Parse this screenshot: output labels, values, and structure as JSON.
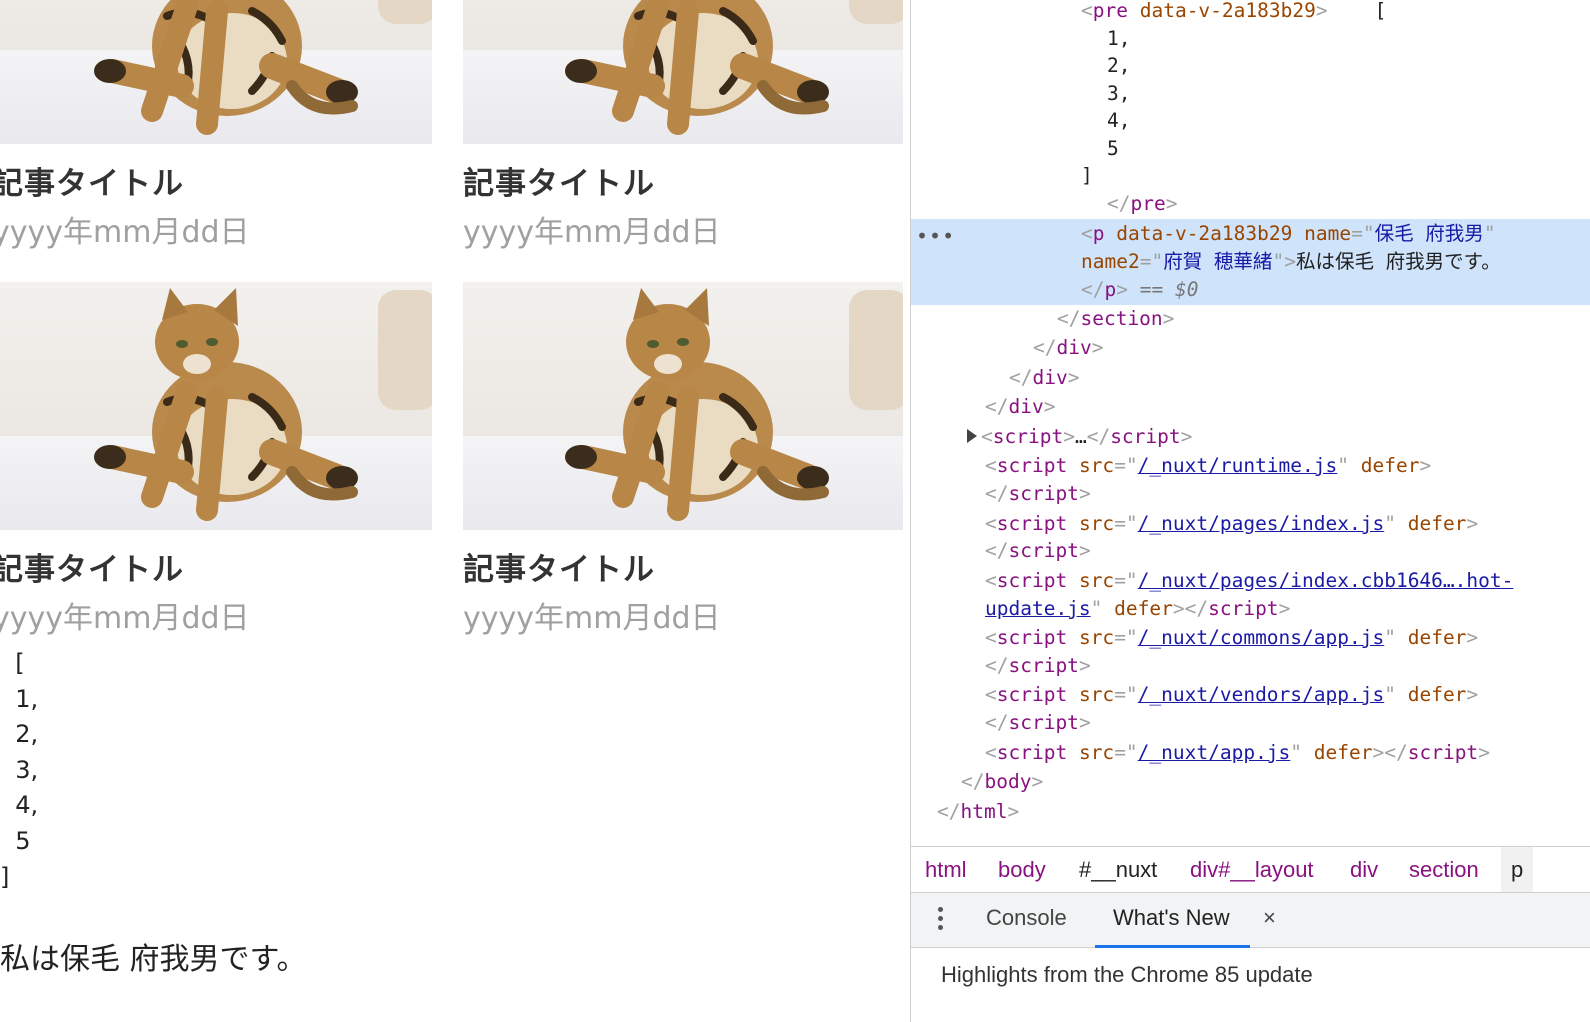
{
  "page": {
    "cards": [
      {
        "title": "記事タイトル",
        "date": "yyyy年mm月dd日",
        "image": "sitting-bengal-cat"
      },
      {
        "title": "記事タイトル",
        "date": "yyyy年mm月dd日",
        "image": "sitting-bengal-cat"
      },
      {
        "title": "記事タイトル",
        "date": "yyyy年mm月dd日",
        "image": "sitting-bengal-cat"
      },
      {
        "title": "記事タイトル",
        "date": "yyyy年mm月dd日",
        "image": "sitting-bengal-cat"
      }
    ],
    "pre_lines": [
      "  [",
      "  1,",
      "  2,",
      "  3,",
      "  4,",
      "  5",
      "]"
    ],
    "paragraph": "私は保毛 府我男です。"
  },
  "devtools": {
    "elements": {
      "pre_tag": "pre",
      "pre_attr": "data-v-2a183b29",
      "pre_open_bracket": "[",
      "pre_values": [
        "1,",
        "2,",
        "3,",
        "4,",
        "5"
      ],
      "pre_close_bracket": "]",
      "p_tag": "p",
      "p_attr1_name": "data-v-2a183b29",
      "p_attr2_name": "name",
      "p_attr2_value": "保毛 府我男",
      "p_attr3_name": "name2",
      "p_attr3_value": "府賀 穂華緒",
      "p_text": "私は保毛 府我男です。",
      "selected_marker": "== $0",
      "dots": "…",
      "closing": [
        "section",
        "div",
        "div",
        "div"
      ],
      "collapsed_script": "…",
      "scripts": [
        {
          "src": "/_nuxt/runtime.js"
        },
        {
          "src": "/_nuxt/pages/index.js"
        },
        {
          "src_line1": "/_nuxt/pages/index.cbb1646….hot-",
          "src_line2": "update.js"
        },
        {
          "src": "/_nuxt/commons/app.js"
        },
        {
          "src": "/_nuxt/vendors/app.js"
        },
        {
          "src": "/_nuxt/app.js"
        }
      ],
      "script_tag": "script",
      "src_attr": "src",
      "defer_attr": "defer",
      "body_tag": "body",
      "html_tag": "html"
    },
    "breadcrumbs": [
      "html",
      "body",
      "#__nuxt",
      "div#__layout",
      "div",
      "section",
      "p"
    ],
    "drawer": {
      "tabs": [
        "Console",
        "What's New"
      ],
      "close_glyph": "×",
      "headline": "Highlights from the Chrome 85 update"
    }
  }
}
